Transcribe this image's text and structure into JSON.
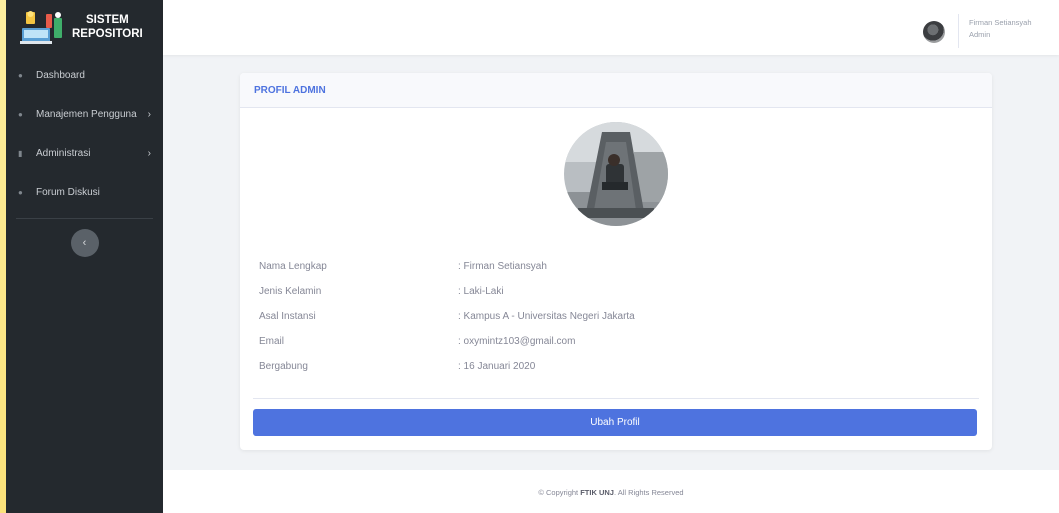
{
  "brand": {
    "line1": "SISTEM",
    "line2": "REPOSITORI"
  },
  "sidebar": {
    "items": [
      {
        "label": "Dashboard",
        "icon": "home-icon",
        "has_submenu": false
      },
      {
        "label": "Manajemen Pengguna",
        "icon": "users-icon",
        "has_submenu": true
      },
      {
        "label": "Administrasi",
        "icon": "document-icon",
        "has_submenu": true
      },
      {
        "label": "Forum Diskusi",
        "icon": "comment-icon",
        "has_submenu": false
      }
    ],
    "collapse_glyph": "‹",
    "chevron_glyph": "›"
  },
  "user": {
    "name": "Firman Setiansyah",
    "role": "Admin"
  },
  "card": {
    "title": "PROFIL ADMIN"
  },
  "profile": {
    "rows": [
      {
        "label": "Nama Lengkap",
        "value": ": Firman Setiansyah"
      },
      {
        "label": "Jenis Kelamin",
        "value": ": Laki-Laki"
      },
      {
        "label": "Asal Instansi",
        "value": ": Kampus A - Universitas Negeri Jakarta"
      },
      {
        "label": "Email",
        "value": ": oxymintz103@gmail.com"
      },
      {
        "label": "Bergabung",
        "value": ": 16 Januari 2020"
      }
    ]
  },
  "actions": {
    "edit_label": "Ubah Profil"
  },
  "footer": {
    "prefix": "© Copyright ",
    "brand": "FTIK UNJ",
    "suffix": ". All Rights Reserved"
  },
  "colors": {
    "primary": "#4e73df",
    "sidebar": "#24292e",
    "background": "#f1f3f6"
  }
}
